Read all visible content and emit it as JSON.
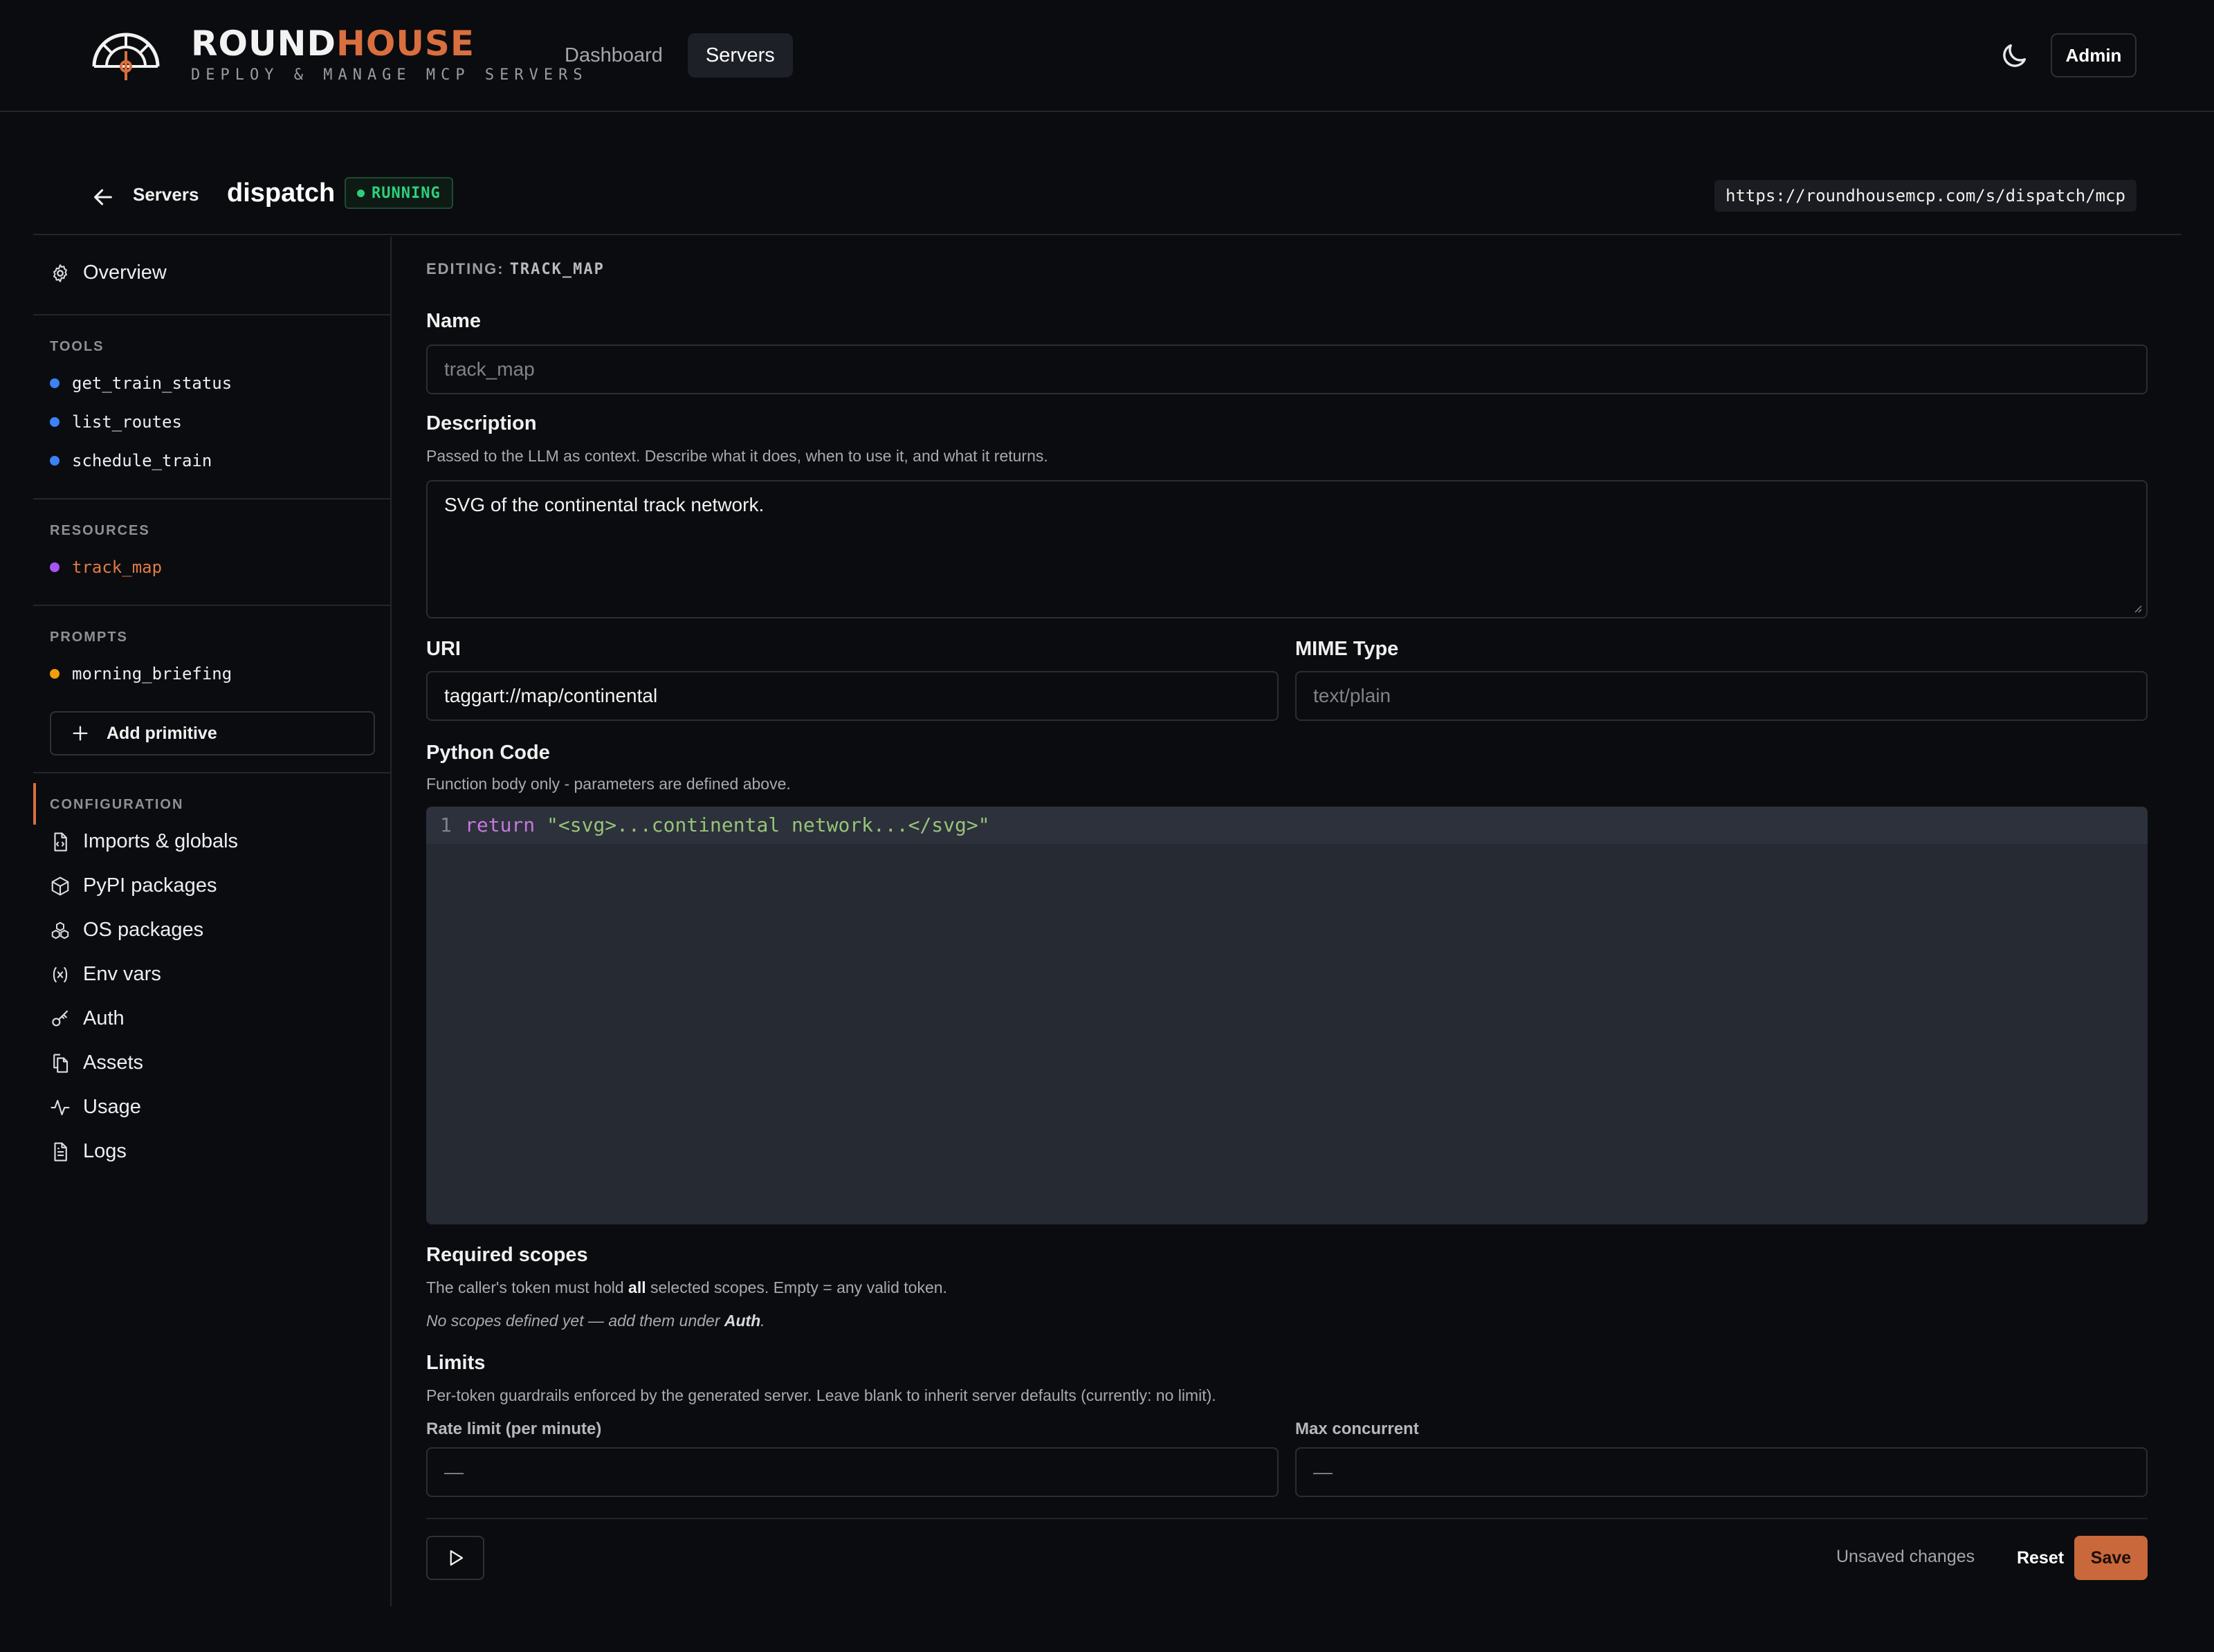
{
  "brand": {
    "name_part1": "ROUND",
    "name_part2": "HOUSE",
    "tagline": "DEPLOY & MANAGE MCP SERVERS"
  },
  "nav": {
    "items": [
      {
        "label": "Dashboard"
      },
      {
        "label": "Servers",
        "active": true
      }
    ]
  },
  "header": {
    "theme_icon": "moon-icon",
    "admin_label": "Admin"
  },
  "server": {
    "back_label": "Servers",
    "name": "dispatch",
    "status": "RUNNING",
    "status_color": "#2ecf7c",
    "url": "https://roundhousemcp.com/s/dispatch/mcp"
  },
  "sidebar": {
    "overview": "Overview",
    "tools_heading": "TOOLS",
    "tools": [
      {
        "name": "get_train_status"
      },
      {
        "name": "list_routes"
      },
      {
        "name": "schedule_train"
      }
    ],
    "resources_heading": "RESOURCES",
    "resources": [
      {
        "name": "track_map",
        "selected": true
      }
    ],
    "prompts_heading": "PROMPTS",
    "prompts": [
      {
        "name": "morning_briefing"
      }
    ],
    "add_primitive": "Add primitive",
    "configuration_heading": "CONFIGURATION",
    "config": [
      {
        "label": "Imports & globals",
        "icon": "file-code-icon"
      },
      {
        "label": "PyPI packages",
        "icon": "package-icon"
      },
      {
        "label": "OS packages",
        "icon": "boxes-icon"
      },
      {
        "label": "Env vars",
        "icon": "variable-icon"
      },
      {
        "label": "Auth",
        "icon": "key-icon"
      },
      {
        "label": "Assets",
        "icon": "files-icon"
      },
      {
        "label": "Usage",
        "icon": "activity-icon"
      },
      {
        "label": "Logs",
        "icon": "file-text-icon"
      }
    ],
    "colors": {
      "tool": "#3b82f6",
      "resource": "#a855f7",
      "prompt": "#f59e0b",
      "accent": "#d96f3f"
    }
  },
  "editor": {
    "editing_prefix": "EDITING:",
    "editing_name": "TRACK_MAP",
    "name_label": "Name",
    "name_placeholder": "track_map",
    "description_label": "Description",
    "description_help": "Passed to the LLM as context. Describe what it does, when to use it, and what it returns.",
    "description_value": "SVG of the continental track network.",
    "uri_label": "URI",
    "uri_value": "taggart://map/continental",
    "mime_label": "MIME Type",
    "mime_placeholder": "text/plain",
    "code_label": "Python Code",
    "code_help": "Function body only - parameters are defined above.",
    "code_line_number": "1",
    "code_keyword": "return",
    "code_string": "\"<svg>...continental network...</svg>\"",
    "scopes_label": "Required scopes",
    "scopes_help_a": "The caller's token must hold ",
    "scopes_help_bold": "all",
    "scopes_help_b": " selected scopes. Empty = any valid token.",
    "scopes_empty_a": "No scopes defined yet — add them under ",
    "scopes_empty_bold": "Auth",
    "scopes_empty_b": ".",
    "limits_label": "Limits",
    "limits_help": "Per-token guardrails enforced by the generated server. Leave blank to inherit server defaults (currently: no limit).",
    "rate_label": "Rate limit (per minute)",
    "rate_placeholder": "—",
    "concurrent_label": "Max concurrent",
    "concurrent_placeholder": "—",
    "unsaved": "Unsaved changes",
    "reset": "Reset",
    "save": "Save",
    "save_color": "#c9683a"
  }
}
